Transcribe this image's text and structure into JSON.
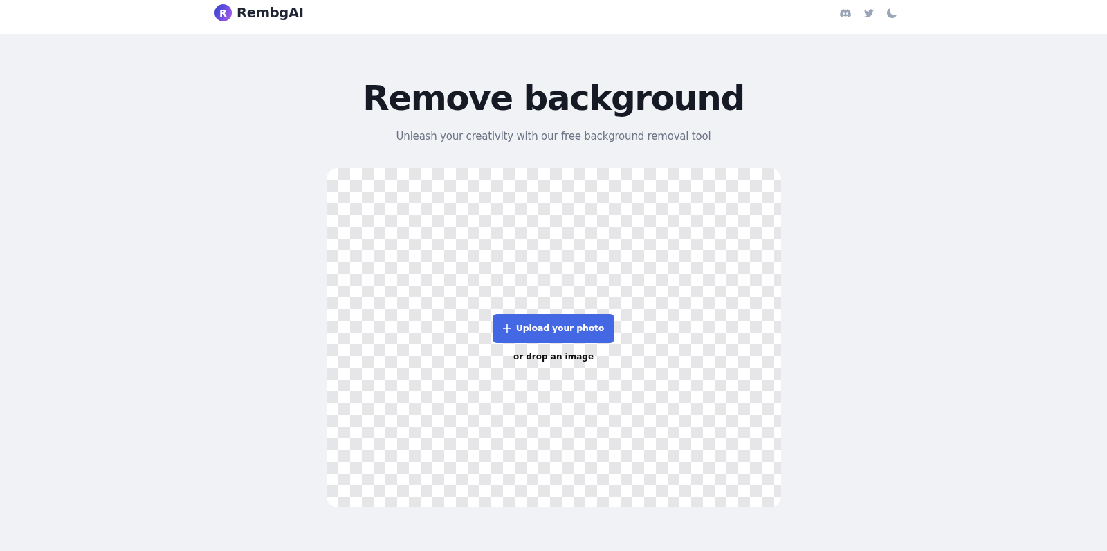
{
  "header": {
    "logo_letter": "R",
    "brand": "RembgAI"
  },
  "hero": {
    "title": "Remove background",
    "subtitle": "Unleash your creativity with our free background removal tool"
  },
  "dropzone": {
    "button_label": "Upload your photo",
    "hint": "or drop an image"
  }
}
